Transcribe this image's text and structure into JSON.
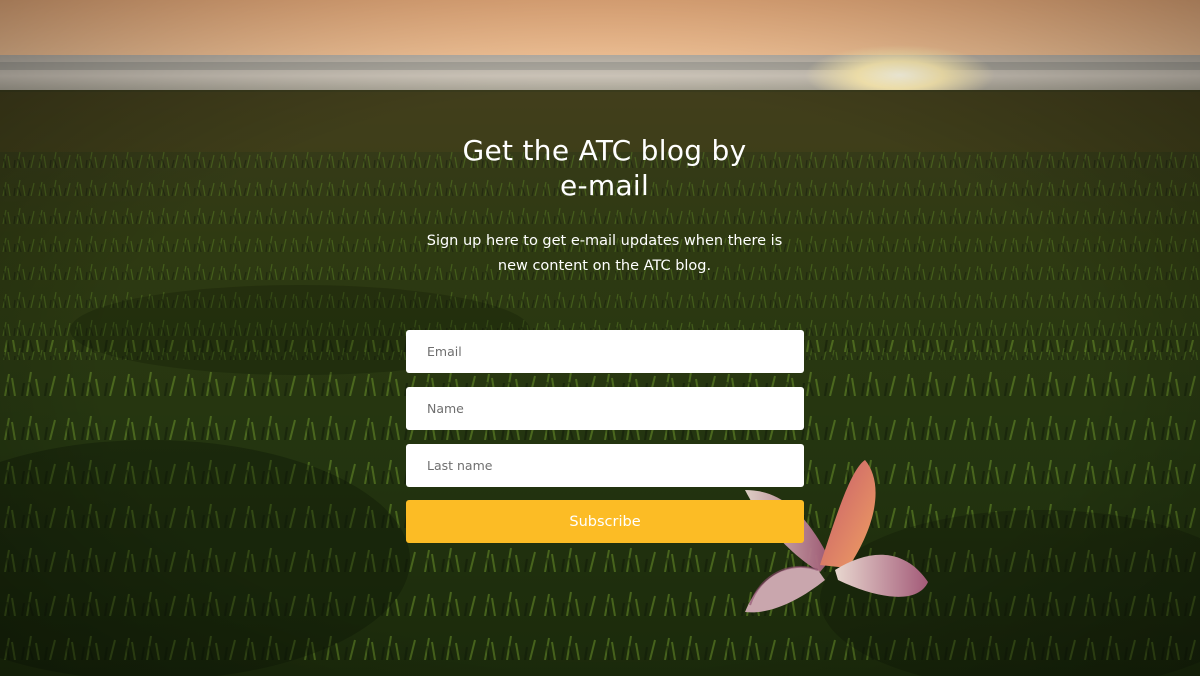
{
  "signup": {
    "heading_line1": "Get the ATC blog by",
    "heading_line2": "e-mail",
    "subtext_line1": "Sign up here to get e-mail updates when there is",
    "subtext_line2": "new content on the ATC blog.",
    "fields": {
      "email_placeholder": "Email",
      "name_placeholder": "Name",
      "last_name_placeholder": "Last name"
    },
    "subscribe_label": "Subscribe"
  },
  "colors": {
    "button": "#fcbc25",
    "text": "#ffffff",
    "field_bg": "#ffffff"
  }
}
